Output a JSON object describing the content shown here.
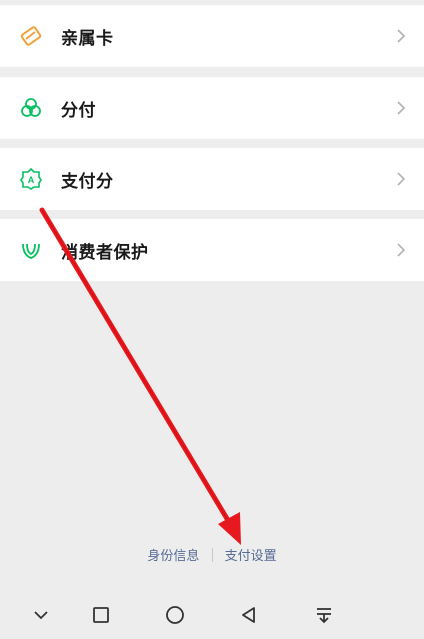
{
  "menu": {
    "items": [
      {
        "label": "亲属卡",
        "icon": "family-card-icon"
      },
      {
        "label": "分付",
        "icon": "fenfu-icon"
      },
      {
        "label": "支付分",
        "icon": "payscore-icon"
      },
      {
        "label": "消费者保护",
        "icon": "consumer-protection-icon"
      }
    ]
  },
  "footer": {
    "identity_label": "身份信息",
    "pay_settings_label": "支付设置"
  },
  "navbar": {
    "icons": [
      "chevron-down-icon",
      "square-icon",
      "circle-icon",
      "back-triangle-icon",
      "notification-pull-icon"
    ]
  },
  "colors": {
    "accent_green": "#07c160",
    "family_card_orange": "#f0a23c",
    "link_blue": "#576b95",
    "annotation_red": "#e8191e"
  }
}
